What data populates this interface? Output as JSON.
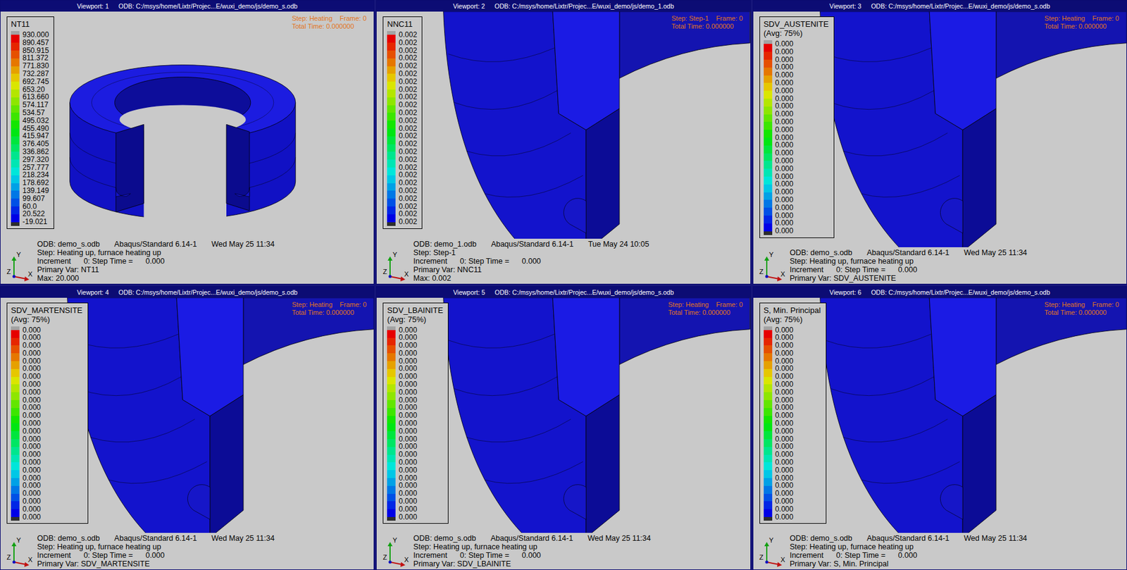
{
  "viewports": [
    {
      "title": "Viewport: 1",
      "odb_path": "ODB: C:/msys/home/Lixtr/Projec...E/wuxi_demo/js/demo_s.odb",
      "view": "ring",
      "legend": {
        "title": "NT11",
        "values": [
          "930.000",
          "890.457",
          "850.915",
          "811.372",
          "771.830",
          "732.287",
          "692.745",
          "653.20",
          "613.660",
          "574.117",
          "534.57",
          "495.032",
          "455.490",
          "415.947",
          "376.405",
          "336.862",
          "297.320",
          "257.777",
          "218.234",
          "178.692",
          "139.149",
          "99.607",
          "60.0",
          "20.522",
          "-19.021"
        ]
      },
      "step_label": "Step: Heating",
      "frame_label": "Frame: 0",
      "total_time": "Total Time: 0.000000",
      "triad": {
        "y": "Y",
        "z": "Z",
        "x": "X"
      },
      "info": {
        "odb": "ODB: demo_s.odb",
        "version": "Abaqus/Standard 6.14-1",
        "date": "Wed May 25 11:34",
        "step": "Step: Heating up, furnace heating up",
        "increment": "Increment      0: Step Time =      0.000",
        "primary": "Primary Var: NT11",
        "extra": "Max: 20.000"
      }
    },
    {
      "title": "Viewport: 2",
      "odb_path": "ODB: C:/msys/home/Lixtr/Projec...E/wuxi_demo/js/demo_1.odb",
      "view": "closeup",
      "legend": {
        "title": "NNC11",
        "values": [
          "0.002",
          "0.002",
          "0.002",
          "0.002",
          "0.002",
          "0.002",
          "0.002",
          "0.002",
          "0.002",
          "0.002",
          "0.002",
          "0.002",
          "0.002",
          "0.002",
          "0.002",
          "0.002",
          "0.002",
          "0.002",
          "0.002",
          "0.002",
          "0.002",
          "0.002",
          "0.002",
          "0.002",
          "0.002"
        ]
      },
      "step_label": "Step: Step-1",
      "frame_label": "Frame: 0",
      "total_time": "Total Time: 0.000000",
      "triad": {
        "y": "Y",
        "z": "Z",
        "x": "X"
      },
      "info": {
        "odb": "ODB: demo_1.odb",
        "version": "Abaqus/Standard 6.14-1",
        "date": "Tue May 24 10:05",
        "step": "Step: Step-1",
        "increment": "Increment      0: Step Time =      0.000",
        "primary": "Primary Var: NNC11",
        "extra": "Max: 0.002"
      }
    },
    {
      "title": "Viewport: 3",
      "odb_path": "ODB: C:/msys/home/Lixtr/Projec...E/wuxi_demo/js/demo_s.odb",
      "view": "closeup",
      "legend": {
        "title": "SDV_AUSTENITE",
        "avg": "(Avg: 75%)",
        "values": [
          "0.000",
          "0.000",
          "0.000",
          "0.000",
          "0.000",
          "0.000",
          "0.000",
          "0.000",
          "0.000",
          "0.000",
          "0.000",
          "0.000",
          "0.000",
          "0.000",
          "0.000",
          "0.000",
          "0.000",
          "0.000",
          "0.000",
          "0.000",
          "0.000",
          "0.000",
          "0.000",
          "0.000",
          "0.000"
        ]
      },
      "step_label": "Step: Heating",
      "frame_label": "Frame: 0",
      "total_time": "Total Time: 0.000000",
      "triad": {
        "y": "Y",
        "z": "Z",
        "x": "X"
      },
      "info": {
        "odb": "ODB: demo_s.odb",
        "version": "Abaqus/Standard 6.14-1",
        "date": "Wed May 25 11:34",
        "step": "Step: Heating up, furnace heating up",
        "increment": "Increment      0: Step Time =      0.000",
        "primary": "Primary Var: SDV_AUSTENITE"
      }
    },
    {
      "title": "Viewport: 4",
      "odb_path": "ODB: C:/msys/home/Lixtr/Projec...E/wuxi_demo/js/demo_s.odb",
      "view": "closeup",
      "legend": {
        "title": "SDV_MARTENSITE",
        "avg": "(Avg: 75%)",
        "values": [
          "0.000",
          "0.000",
          "0.000",
          "0.000",
          "0.000",
          "0.000",
          "0.000",
          "0.000",
          "0.000",
          "0.000",
          "0.000",
          "0.000",
          "0.000",
          "0.000",
          "0.000",
          "0.000",
          "0.000",
          "0.000",
          "0.000",
          "0.000",
          "0.000",
          "0.000",
          "0.000",
          "0.000",
          "0.000"
        ]
      },
      "step_label": "Step: Heating",
      "frame_label": "Frame: 0",
      "total_time": "Total Time: 0.000000",
      "triad": {
        "y": "Y",
        "z": "Z",
        "x": "X"
      },
      "info": {
        "odb": "ODB: demo_s.odb",
        "version": "Abaqus/Standard 6.14-1",
        "date": "Wed May 25 11:34",
        "step": "Step: Heating up, furnace heating up",
        "increment": "Increment      0: Step Time =      0.000",
        "primary": "Primary Var: SDV_MARTENSITE"
      }
    },
    {
      "title": "Viewport: 5",
      "odb_path": "ODB: C:/msys/home/Lixtr/Projec...E/wuxi_demo/js/demo_s.odb",
      "view": "closeup",
      "legend": {
        "title": "SDV_LBAINITE",
        "avg": "(Avg: 75%)",
        "values": [
          "0.000",
          "0.000",
          "0.000",
          "0.000",
          "0.000",
          "0.000",
          "0.000",
          "0.000",
          "0.000",
          "0.000",
          "0.000",
          "0.000",
          "0.000",
          "0.000",
          "0.000",
          "0.000",
          "0.000",
          "0.000",
          "0.000",
          "0.000",
          "0.000",
          "0.000",
          "0.000",
          "0.000",
          "0.000"
        ]
      },
      "step_label": "Step: Heating",
      "frame_label": "Frame: 0",
      "total_time": "Total Time: 0.000000",
      "triad": {
        "y": "Y",
        "z": "Z",
        "x": "X"
      },
      "info": {
        "odb": "ODB: demo_s.odb",
        "version": "Abaqus/Standard 6.14-1",
        "date": "Wed May 25 11:34",
        "step": "Step: Heating up, furnace heating up",
        "increment": "Increment      0: Step Time =      0.000",
        "primary": "Primary Var: SDV_LBAINITE"
      }
    },
    {
      "title": "Viewport: 6",
      "odb_path": "ODB: C:/msys/home/Lixtr/Projec...E/wuxi_demo/js/demo_s.odb",
      "view": "closeup",
      "legend": {
        "title": "S, Min. Principal",
        "avg": "(Avg: 75%)",
        "values": [
          "0.000",
          "0.000",
          "0.000",
          "0.000",
          "0.000",
          "0.000",
          "0.000",
          "0.000",
          "0.000",
          "0.000",
          "0.000",
          "0.000",
          "0.000",
          "0.000",
          "0.000",
          "0.000",
          "0.000",
          "0.000",
          "0.000",
          "0.000",
          "0.000",
          "0.000",
          "0.000",
          "0.000",
          "0.000"
        ]
      },
      "step_label": "Step: Heating",
      "frame_label": "Frame: 0",
      "total_time": "Total Time: 0.000000",
      "triad": {
        "y": "Y",
        "z": "Z",
        "x": "X"
      },
      "info": {
        "odb": "ODB: demo_s.odb",
        "version": "Abaqus/Standard 6.14-1",
        "date": "Wed May 25 11:34",
        "step": "Step: Heating up, furnace heating up",
        "increment": "Increment      0: Step Time =      0.000",
        "primary": "Primary Var: S, Min. Principal"
      }
    }
  ]
}
